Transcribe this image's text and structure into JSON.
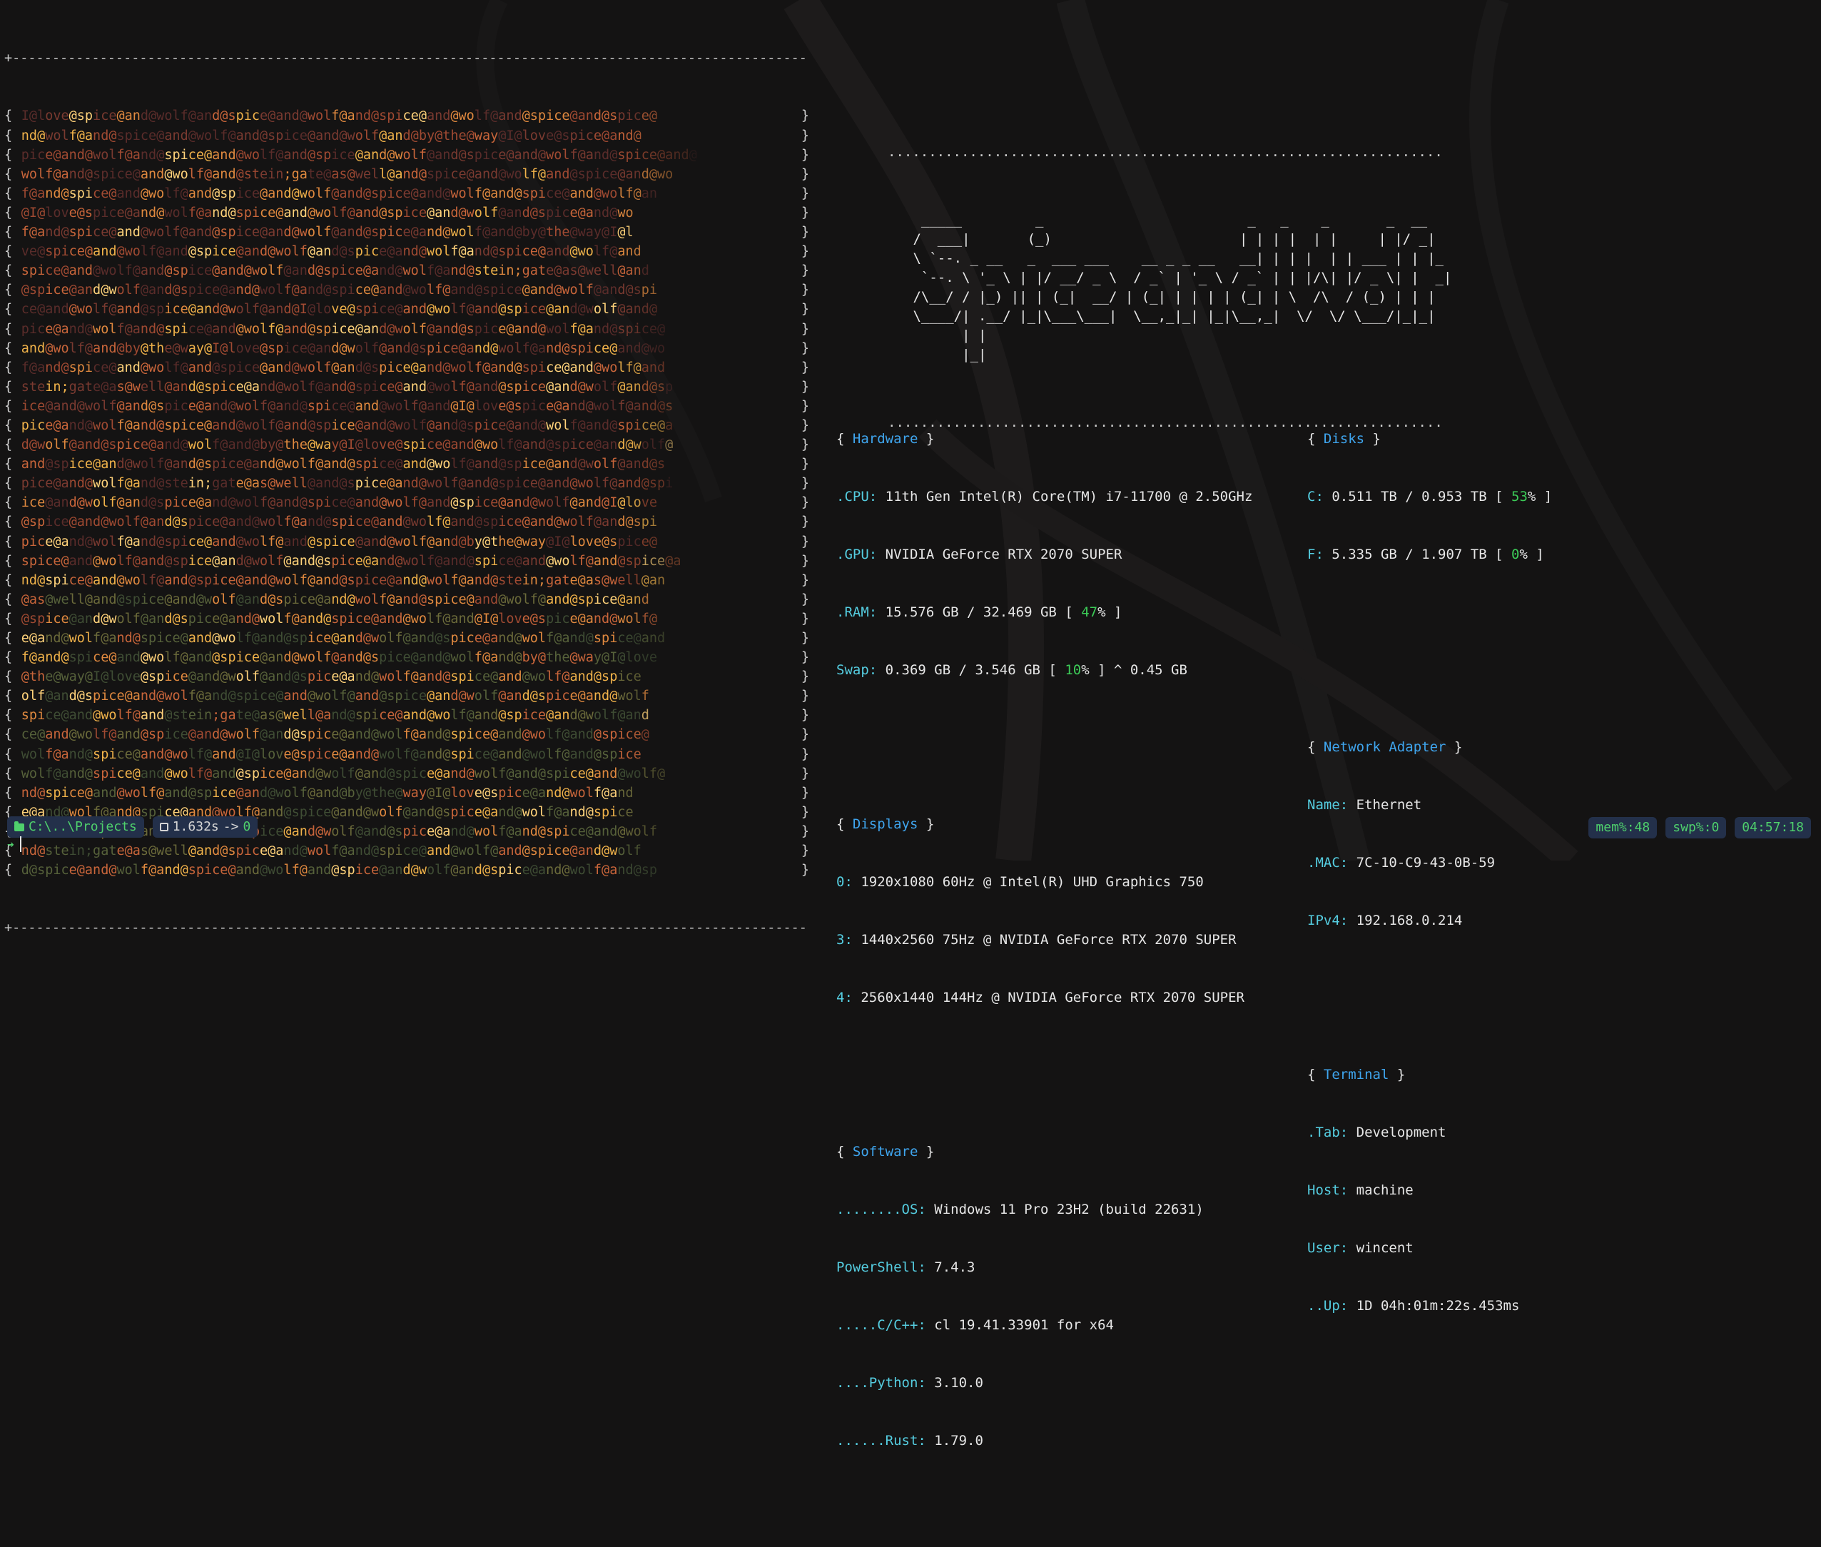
{
  "colors": {
    "background": "#141313",
    "section_title": "#3fa5ee",
    "label_cyan": "#55cde0",
    "percent_green": "#3ccb57",
    "status_green": "#4fd06c",
    "pill_bg": "#23304a",
    "rain_palette": [
      "#5a2c2a",
      "#7a3a30",
      "#a04a32",
      "#c8653a",
      "#e0893f",
      "#f0b24a",
      "#ffd27a",
      "#8b6a34",
      "#6b6a3a",
      "#56613a",
      "#3f4d34"
    ]
  },
  "left_panel": {
    "border_top": "+-------------------------------------------------------------------------------------------------------+",
    "border_bottom": "+-------------------------------------------------------------------------------------------------------+",
    "rows": [
      "I@love@spice@and@wolf@and@spice@and@wolf@and@spice@and@wolf@and@spice@and@spice@",
      "nd@wolf@and@spice@and@wolf@and@spice@and@wolf@and@by@the@way@I@love@spice@and@",
      "pice@and@wolf@and@spice@and@wolf@and@spice@and@wolf@and@spice@and@wolf@and@spice@and@",
      "wolf@and@spice@and@wolf@and@stein;gate@as@well@and@spice@and@wolf@and@spice@and@wo",
      "f@and@spice@and@wolf@and@spice@and@wolf@and@spice@and@wolf@and@spice@and@wolf@an",
      "@I@love@spice@and@wolf@and@spice@and@wolf@and@spice@and@wolf@and@spice@and@wo",
      "f@and@spice@and@wolf@and@spice@and@wolf@and@spice@and@wolf@and@by@the@way@I@l",
      "ve@spice@and@wolf@and@spice@and@wolf@and@spice@and@wolf@and@spice@and@wolf@and",
      "spice@and@wolf@and@spice@and@wolf@and@spice@and@wolf@and@stein;gate@as@well@and",
      "@spice@and@wolf@and@spice@and@wolf@and@spice@and@wolf@and@spice@and@wolf@and@spi",
      "ce@and@wolf@and@spice@and@wolf@and@I@love@spice@and@wolf@and@spice@and@wolf@and@",
      "pice@and@wolf@and@spice@and@wolf@and@spice@and@wolf@and@spice@and@wolf@and@spice@",
      "and@wolf@and@by@the@way@I@love@spice@and@wolf@and@spice@and@wolf@and@spice@and@wo",
      "f@and@spice@and@wolf@and@spice@and@wolf@and@spice@and@wolf@and@spice@and@wolf@and",
      "stein;gate@as@well@and@spice@and@wolf@and@spice@and@wolf@and@spice@and@wolf@and@sp",
      "ice@and@wolf@and@spice@and@wolf@and@spice@and@wolf@and@I@love@spice@and@wolf@and@s",
      "pice@and@wolf@and@spice@and@wolf@and@spice@and@wolf@and@spice@and@wolf@and@spice@a",
      "d@wolf@and@spice@and@wolf@and@by@the@way@I@love@spice@and@wolf@and@spice@and@wolf@",
      "and@spice@and@wolf@and@spice@and@wolf@and@spice@and@wolf@and@spice@and@wolf@and@s",
      "pice@and@wolf@and@stein;gate@as@well@and@spice@and@wolf@and@spice@and@wolf@and@spi",
      "ice@and@wolf@and@spice@and@wolf@and@spice@and@wolf@and@spice@and@wolf@and@I@love",
      "@spice@and@wolf@and@spice@and@wolf@and@spice@and@wolf@and@spice@and@wolf@and@spi",
      "pice@and@wolf@and@spice@and@wolf@and@spice@and@wolf@and@by@the@way@I@love@spice@",
      "spice@and@wolf@and@spice@and@wolf@and@spice@and@wolf@and@spice@and@wolf@and@spice@a",
      "nd@spice@and@wolf@and@spice@and@wolf@and@spice@and@wolf@and@stein;gate@as@well@an",
      "@as@well@and@spice@and@wolf@and@spice@and@wolf@and@spice@and@wolf@and@spice@and",
      "@spice@and@wolf@and@spice@and@wolf@and@spice@and@wolf@and@I@love@spice@and@wolf@",
      "e@and@wolf@and@spice@and@wolf@and@spice@and@wolf@and@spice@and@wolf@and@spice@and",
      "f@and@spice@and@wolf@and@spice@and@wolf@and@spice@and@wolf@and@by@the@way@I@love",
      "@the@way@I@love@spice@and@wolf@and@spice@and@wolf@and@spice@and@wolf@and@spice",
      "olf@and@spice@and@wolf@and@spice@and@wolf@and@spice@and@wolf@and@spice@and@wolf",
      "spice@and@wolf@and@stein;gate@as@well@and@spice@and@wolf@and@spice@and@wolf@and",
      "ce@and@wolf@and@spice@and@wolf@and@spice@and@wolf@and@spice@and@wolf@and@spice@",
      "wolf@and@spice@and@wolf@and@I@love@spice@and@wolf@and@spice@and@wolf@and@spice",
      "wolf@and@spice@and@wolf@and@spice@and@wolf@and@spice@and@wolf@and@spice@and@wolf@",
      "nd@spice@and@wolf@and@spice@and@wolf@and@by@the@way@I@love@spice@and@wolf@and",
      "e@and@wolf@and@spice@and@wolf@and@spice@and@wolf@and@spice@and@wolf@and@spice",
      "wolf@and@spice@and@wolf@and@spice@and@wolf@and@spice@and@wolf@and@spice@and@wolf",
      "nd@stein;gate@as@well@and@spice@and@wolf@and@spice@and@wolf@and@spice@and@wolf",
      "d@spice@and@wolf@and@spice@and@wolf@and@spice@and@wolf@and@spice@and@wolf@and@sp"
    ]
  },
  "right_panel": {
    "dots": "....................................................................",
    "ascii_logo": [
      "  _____         _                         _   _    _       _  __",
      " /  ___|       (_)                       | | | |  | |     | |/ _|",
      " \\ `--. _ __   _  ___ ___    __ _ _ __   __| | | |  | | ___ | | |_",
      "  `--. \\ '_ \\ | |/ __/ _ \\  / _` | '_ \\ / _` | | |/\\| |/ _ \\| |  _|",
      " /\\__/ / |_) || | (_|  __/ | (_| | | | | (_| | \\  /\\  / (_) | | |",
      " \\____/| .__/ |_|\\___\\___|  \\__,_|_| |_|\\__,_|  \\/  \\/ \\___/|_|_|",
      "       | |",
      "       |_|"
    ],
    "hardware": {
      "title": "Hardware",
      "cpu_label": ".CPU:",
      "cpu": "11th Gen Intel(R) Core(TM) i7-11700 @ 2.50GHz",
      "gpu_label": ".GPU:",
      "gpu": "NVIDIA GeForce RTX 2070 SUPER",
      "ram_label": ".RAM:",
      "ram": "15.576 GB / 32.469 GB [",
      "ram_pct": "47",
      "ram_end": "% ]",
      "swap_label": "Swap:",
      "swap": "0.369 GB / 3.546 GB [",
      "swap_pct": "10",
      "swap_end": "% ] ^ 0.45 GB"
    },
    "displays": {
      "title": "Displays",
      "d0_label": "0:",
      "d0": "1920x1080 60Hz @ Intel(R) UHD Graphics 750",
      "d3_label": "3:",
      "d3": "1440x2560 75Hz @ NVIDIA GeForce RTX 2070 SUPER",
      "d4_label": "4:",
      "d4": "2560x1440 144Hz @ NVIDIA GeForce RTX 2070 SUPER"
    },
    "software": {
      "title": "Software",
      "os_label": "........OS:",
      "os": "Windows 11 Pro 23H2 (build 22631)",
      "ps_label": "PowerShell:",
      "ps": "7.4.3",
      "cpp_label": ".....C/C++:",
      "cpp": "cl 19.41.33901 for x64",
      "py_label": "....Python:",
      "py": "3.10.0",
      "rust_label": "......Rust:",
      "rust": "1.79.0"
    },
    "disks": {
      "title": "Disks",
      "c_label": "C:",
      "c": "0.511 TB / 0.953 TB [",
      "c_pct": "53",
      "c_end": "% ]",
      "f_label": "F:",
      "f": "5.335 GB / 1.907 TB [",
      "f_pct": "0",
      "f_end": "% ]"
    },
    "network": {
      "title": "Network Adapter",
      "name_label": "Name:",
      "name": "Ethernet",
      "mac_label": ".MAC:",
      "mac": "7C-10-C9-43-0B-59",
      "ip_label": "IPv4:",
      "ip": "192.168.0.214"
    },
    "terminal": {
      "title": "Terminal",
      "tab_label": ".Tab:",
      "tab": "Development",
      "host_label": "Host:",
      "host": "machine",
      "user_label": "User:",
      "user": "wincent",
      "up_label": "..Up:",
      "up": "1D 04h:01m:22s.453ms"
    }
  },
  "status_bar": {
    "path": "C:\\..\\Projects",
    "duration": "1.632s",
    "arrow": "->",
    "exit_code": "0",
    "mem": "mem%:48",
    "swp": "swp%:0",
    "clock": "04:57:18",
    "prompt_symbol": "➜"
  }
}
